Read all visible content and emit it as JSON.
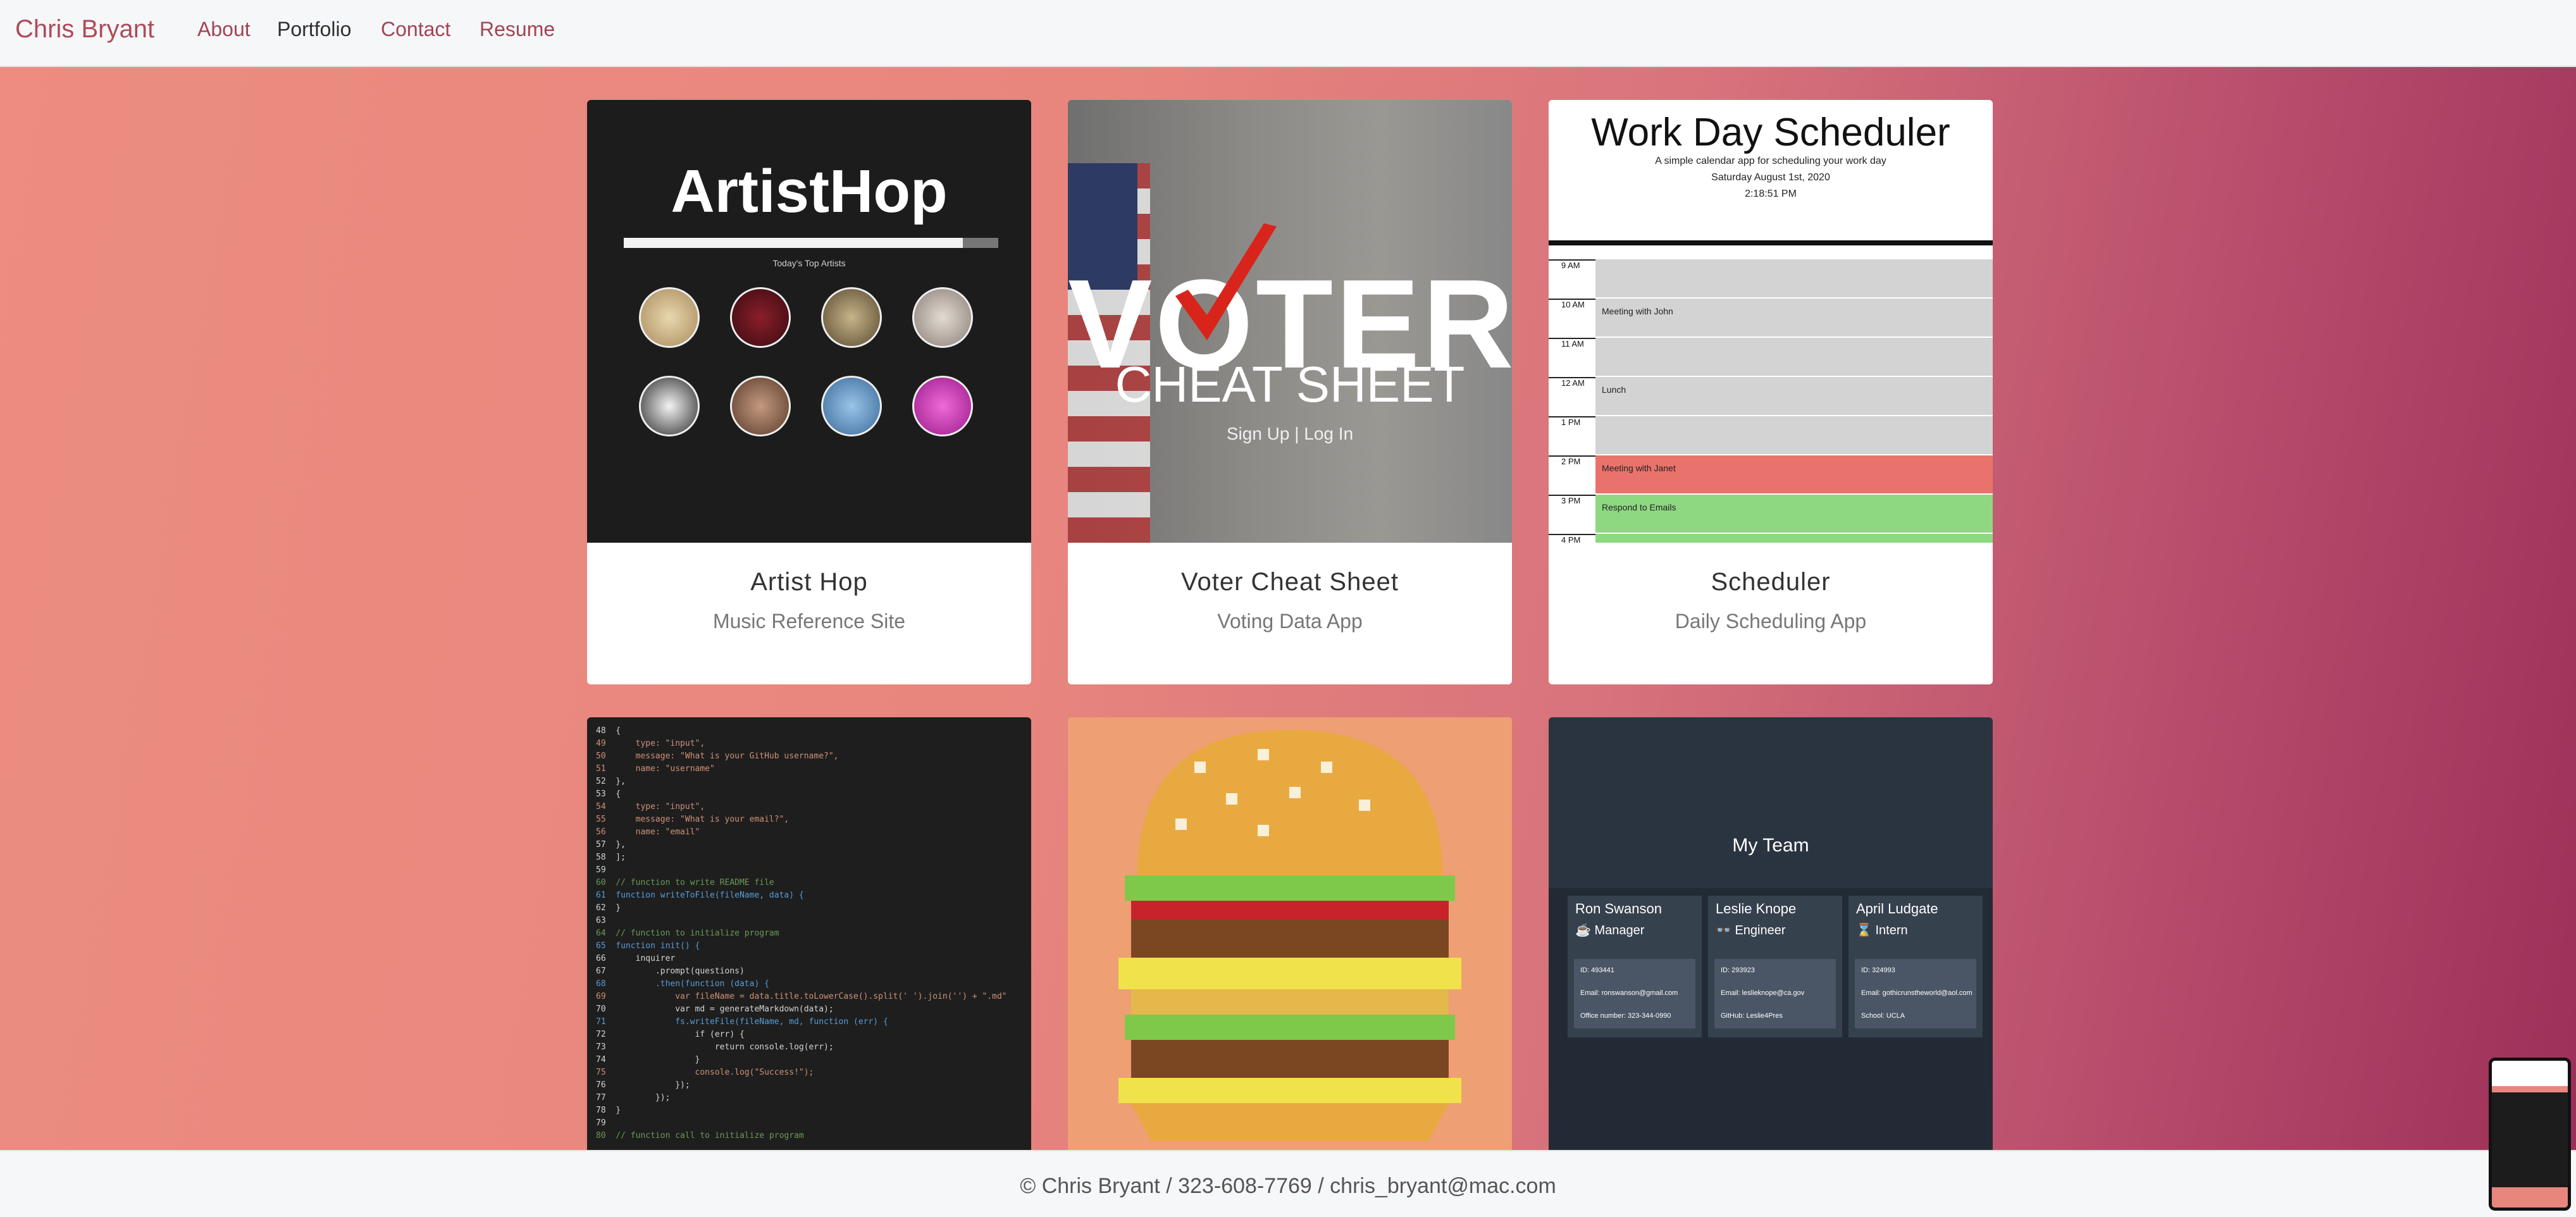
{
  "nav": {
    "brand": "Chris Bryant",
    "links": [
      "About",
      "Portfolio",
      "Contact",
      "Resume"
    ]
  },
  "cards": [
    {
      "title": "Artist Hop",
      "subtitle": "Music Reference Site"
    },
    {
      "title": "Voter Cheat Sheet",
      "subtitle": "Voting Data App"
    },
    {
      "title": "Scheduler",
      "subtitle": "Daily Scheduling App"
    }
  ],
  "artist_hop": {
    "logo": "ArtistHop",
    "caption": "Today's Top Artists"
  },
  "voter": {
    "big": "VOTER",
    "cheat": "CHEAT SHEET",
    "sign": "Sign Up | Log In"
  },
  "scheduler": {
    "title": "Work Day Scheduler",
    "sub1": "A simple calendar app for scheduling your work day",
    "sub2": "Saturday August 1st, 2020",
    "sub3": "2:18:51 PM",
    "rows": [
      {
        "hour": "9 AM",
        "event": ""
      },
      {
        "hour": "10 AM",
        "event": "Meeting with John"
      },
      {
        "hour": "11 AM",
        "event": ""
      },
      {
        "hour": "12 AM",
        "event": "Lunch"
      },
      {
        "hour": "1 PM",
        "event": ""
      },
      {
        "hour": "2 PM",
        "event": "Meeting with Janet"
      },
      {
        "hour": "3 PM",
        "event": "Respond to Emails"
      },
      {
        "hour": "4 PM",
        "event": ""
      }
    ]
  },
  "code": {
    "lines": [
      "48  {",
      "49      type: \"input\",",
      "50      message: \"What is your GitHub username?\",",
      "51      name: \"username\"",
      "52  },",
      "53  {",
      "54      type: \"input\",",
      "55      message: \"What is your email?\",",
      "56      name: \"email\"",
      "57  },",
      "58  ];",
      "59",
      "60  // function to write README file",
      "61  function writeToFile(fileName, data) {",
      "62  }",
      "63",
      "64  // function to initialize program",
      "65  function init() {",
      "66      inquirer",
      "67          .prompt(questions)",
      "68          .then(function (data) {",
      "69              var fileName = data.title.toLowerCase().split(' ').join('') + \".md\"",
      "70              var md = generateMarkdown(data);",
      "71              fs.writeFile(fileName, md, function (err) {",
      "72                  if (err) {",
      "73                      return console.log(err);",
      "74                  }",
      "75                  console.log(\"Success!\");",
      "76              });",
      "77          });",
      "78  }",
      "79",
      "80  // function call to initialize program"
    ]
  },
  "team": {
    "title": "My Team",
    "members": [
      {
        "name": "Ron Swanson",
        "role": "Manager",
        "icon": "coffee-icon",
        "id": "ID: 493441",
        "email": "Email: ronswanson@gmail.com",
        "extra": "Office number: 323-344-0990"
      },
      {
        "name": "Leslie Knope",
        "role": "Engineer",
        "icon": "glasses-icon",
        "id": "ID: 293923",
        "email": "Email: leslieknope@ca.gov",
        "extra": "GitHub: Leslie4Pres"
      },
      {
        "name": "April Ludgate",
        "role": "Intern",
        "icon": "graduate-icon",
        "id": "ID: 324993",
        "email": "Email: gothicrunstheworld@aol.com",
        "extra": "School: UCLA"
      }
    ]
  },
  "footer": {
    "text": "© Chris Bryant / 323-608-7769 / chris_bryant@mac.com"
  },
  "colors": {
    "accent": "#b04a5a",
    "gradient_start": "#ec8d80",
    "gradient_end": "#9b2f58"
  }
}
